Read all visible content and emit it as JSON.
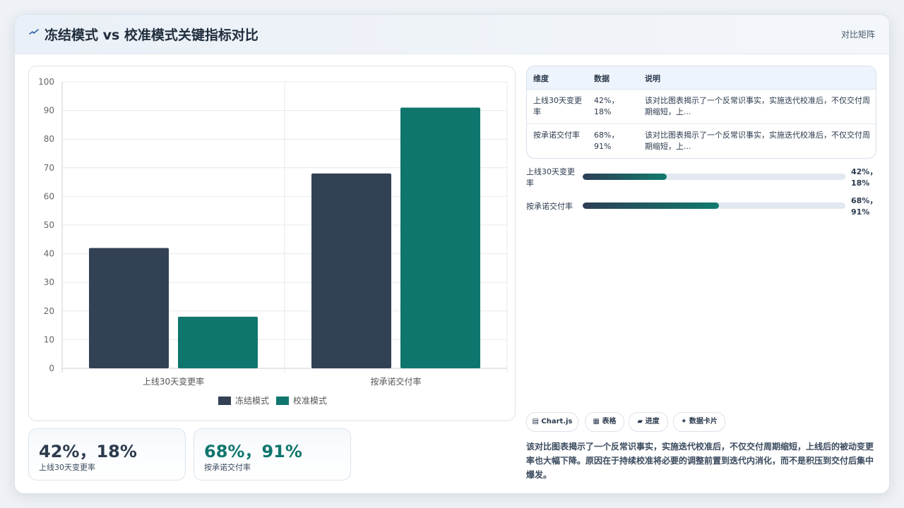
{
  "header": {
    "title": "冻结模式 vs 校准模式关键指标对比",
    "right_label": "对比矩阵"
  },
  "chart_data": {
    "type": "bar",
    "categories": [
      "上线30天变更率",
      "按承诺交付率"
    ],
    "series": [
      {
        "name": "冻结模式",
        "values": [
          42,
          68
        ],
        "color": "#334155"
      },
      {
        "name": "校准模式",
        "values": [
          18,
          91
        ],
        "color": "#0f766e"
      }
    ],
    "title": "",
    "xlabel": "",
    "ylabel": "",
    "ylim": [
      0,
      100
    ],
    "yticks": [
      0,
      10,
      20,
      30,
      40,
      50,
      60,
      70,
      80,
      90,
      100
    ],
    "grid": true,
    "legend": "bottom"
  },
  "kpis": [
    {
      "value": "42%，18%",
      "label": "上线30天变更率",
      "color": "#2d3b4e"
    },
    {
      "value": "68%，91%",
      "label": "按承诺交付率",
      "color": "#0f766e"
    }
  ],
  "table": {
    "headers": [
      "维度",
      "数据",
      "说明"
    ],
    "rows": [
      {
        "dim": "上线30天变更率",
        "data": "42%，18%",
        "note": "该对比图表揭示了一个反常识事实，实施迭代校准后，不仅交付周期缩短，上..."
      },
      {
        "dim": "按承诺交付率",
        "data": "68%，91%",
        "note": "该对比图表揭示了一个反常识事实，实施迭代校准后，不仅交付周期缩短，上..."
      }
    ]
  },
  "progress": [
    {
      "label": "上线30天变更率",
      "value": "42%，18%",
      "fraction": 0.32
    },
    {
      "label": "按承诺交付率",
      "value": "68%，91%",
      "fraction": 0.52
    }
  ],
  "chips": [
    "▤ Chart.js",
    "▦ 表格",
    "▰ 进度",
    "✦ 数据卡片"
  ],
  "description": "该对比图表揭示了一个反常识事实，实施迭代校准后，不仅交付周期缩短，上线后的被动变更率也大幅下降。原因在于持续校准将必要的调整前置到迭代内消化，而不是积压到交付后集中爆发。"
}
